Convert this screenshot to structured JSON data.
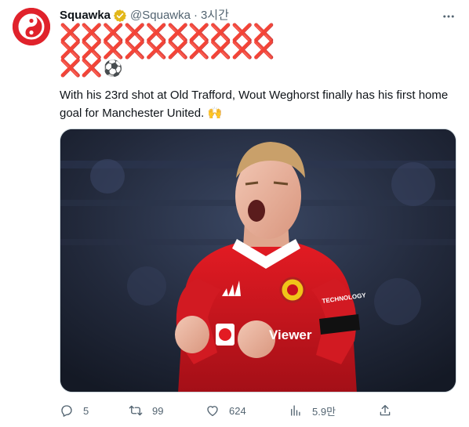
{
  "tweet": {
    "display_name": "Squawka",
    "verified_icon": "verified-badge-icon",
    "handle": "@Squawka",
    "separator": "·",
    "time": "3시간",
    "x_lines": [
      "❌❌❌❌❌❌❌❌❌❌",
      "❌❌❌❌❌❌❌❌❌❌",
      "❌❌"
    ],
    "ball": "⚽",
    "text": "With his 23rd shot at Old Trafford, Wout Weghorst finally has his first home goal for Manchester United.",
    "text_emoji": "🙌",
    "media_shirt_sponsor": "Viewer",
    "media_sleeve_text": "TECHNOLOGY"
  },
  "actions": {
    "reply_count": "5",
    "retweet_count": "99",
    "like_count": "624",
    "views_count": "5.9만"
  },
  "colors": {
    "brand_red": "#e0222b",
    "x_red": "#e0245e",
    "text_primary": "#0f1419",
    "text_secondary": "#536471",
    "verified_gold": "#e2b719"
  }
}
